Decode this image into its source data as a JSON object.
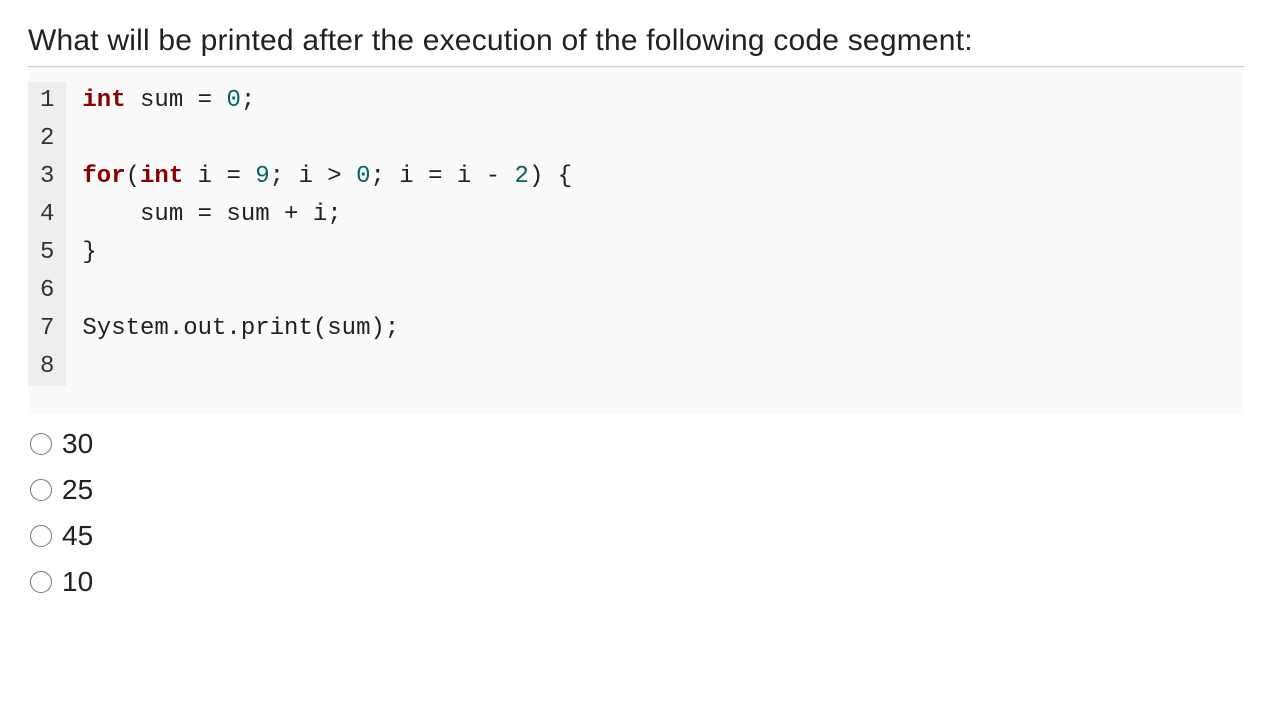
{
  "question": "What will be printed after the execution of the following code segment:",
  "code": {
    "lines": [
      "1",
      "2",
      "3",
      "4",
      "5",
      "6",
      "7",
      "8"
    ],
    "l1_kw1": "int",
    "l1_txt": " sum = ",
    "l1_num": "0",
    "l1_end": ";",
    "l3_kw1": "for",
    "l3_p1": "(",
    "l3_kw2": "int",
    "l3_t1": " i = ",
    "l3_n1": "9",
    "l3_t2": "; i > ",
    "l3_n2": "0",
    "l3_t3": "; i = i - ",
    "l3_n3": "2",
    "l3_t4": ") {",
    "l4": "    sum = sum + i;",
    "l5": "}",
    "l7_t1": "System.out.",
    "l7_fn": "print",
    "l7_t2": "(sum);"
  },
  "options": [
    {
      "id": "opt-30",
      "label": "30"
    },
    {
      "id": "opt-25",
      "label": "25"
    },
    {
      "id": "opt-45",
      "label": "45"
    },
    {
      "id": "opt-10",
      "label": "10"
    }
  ]
}
